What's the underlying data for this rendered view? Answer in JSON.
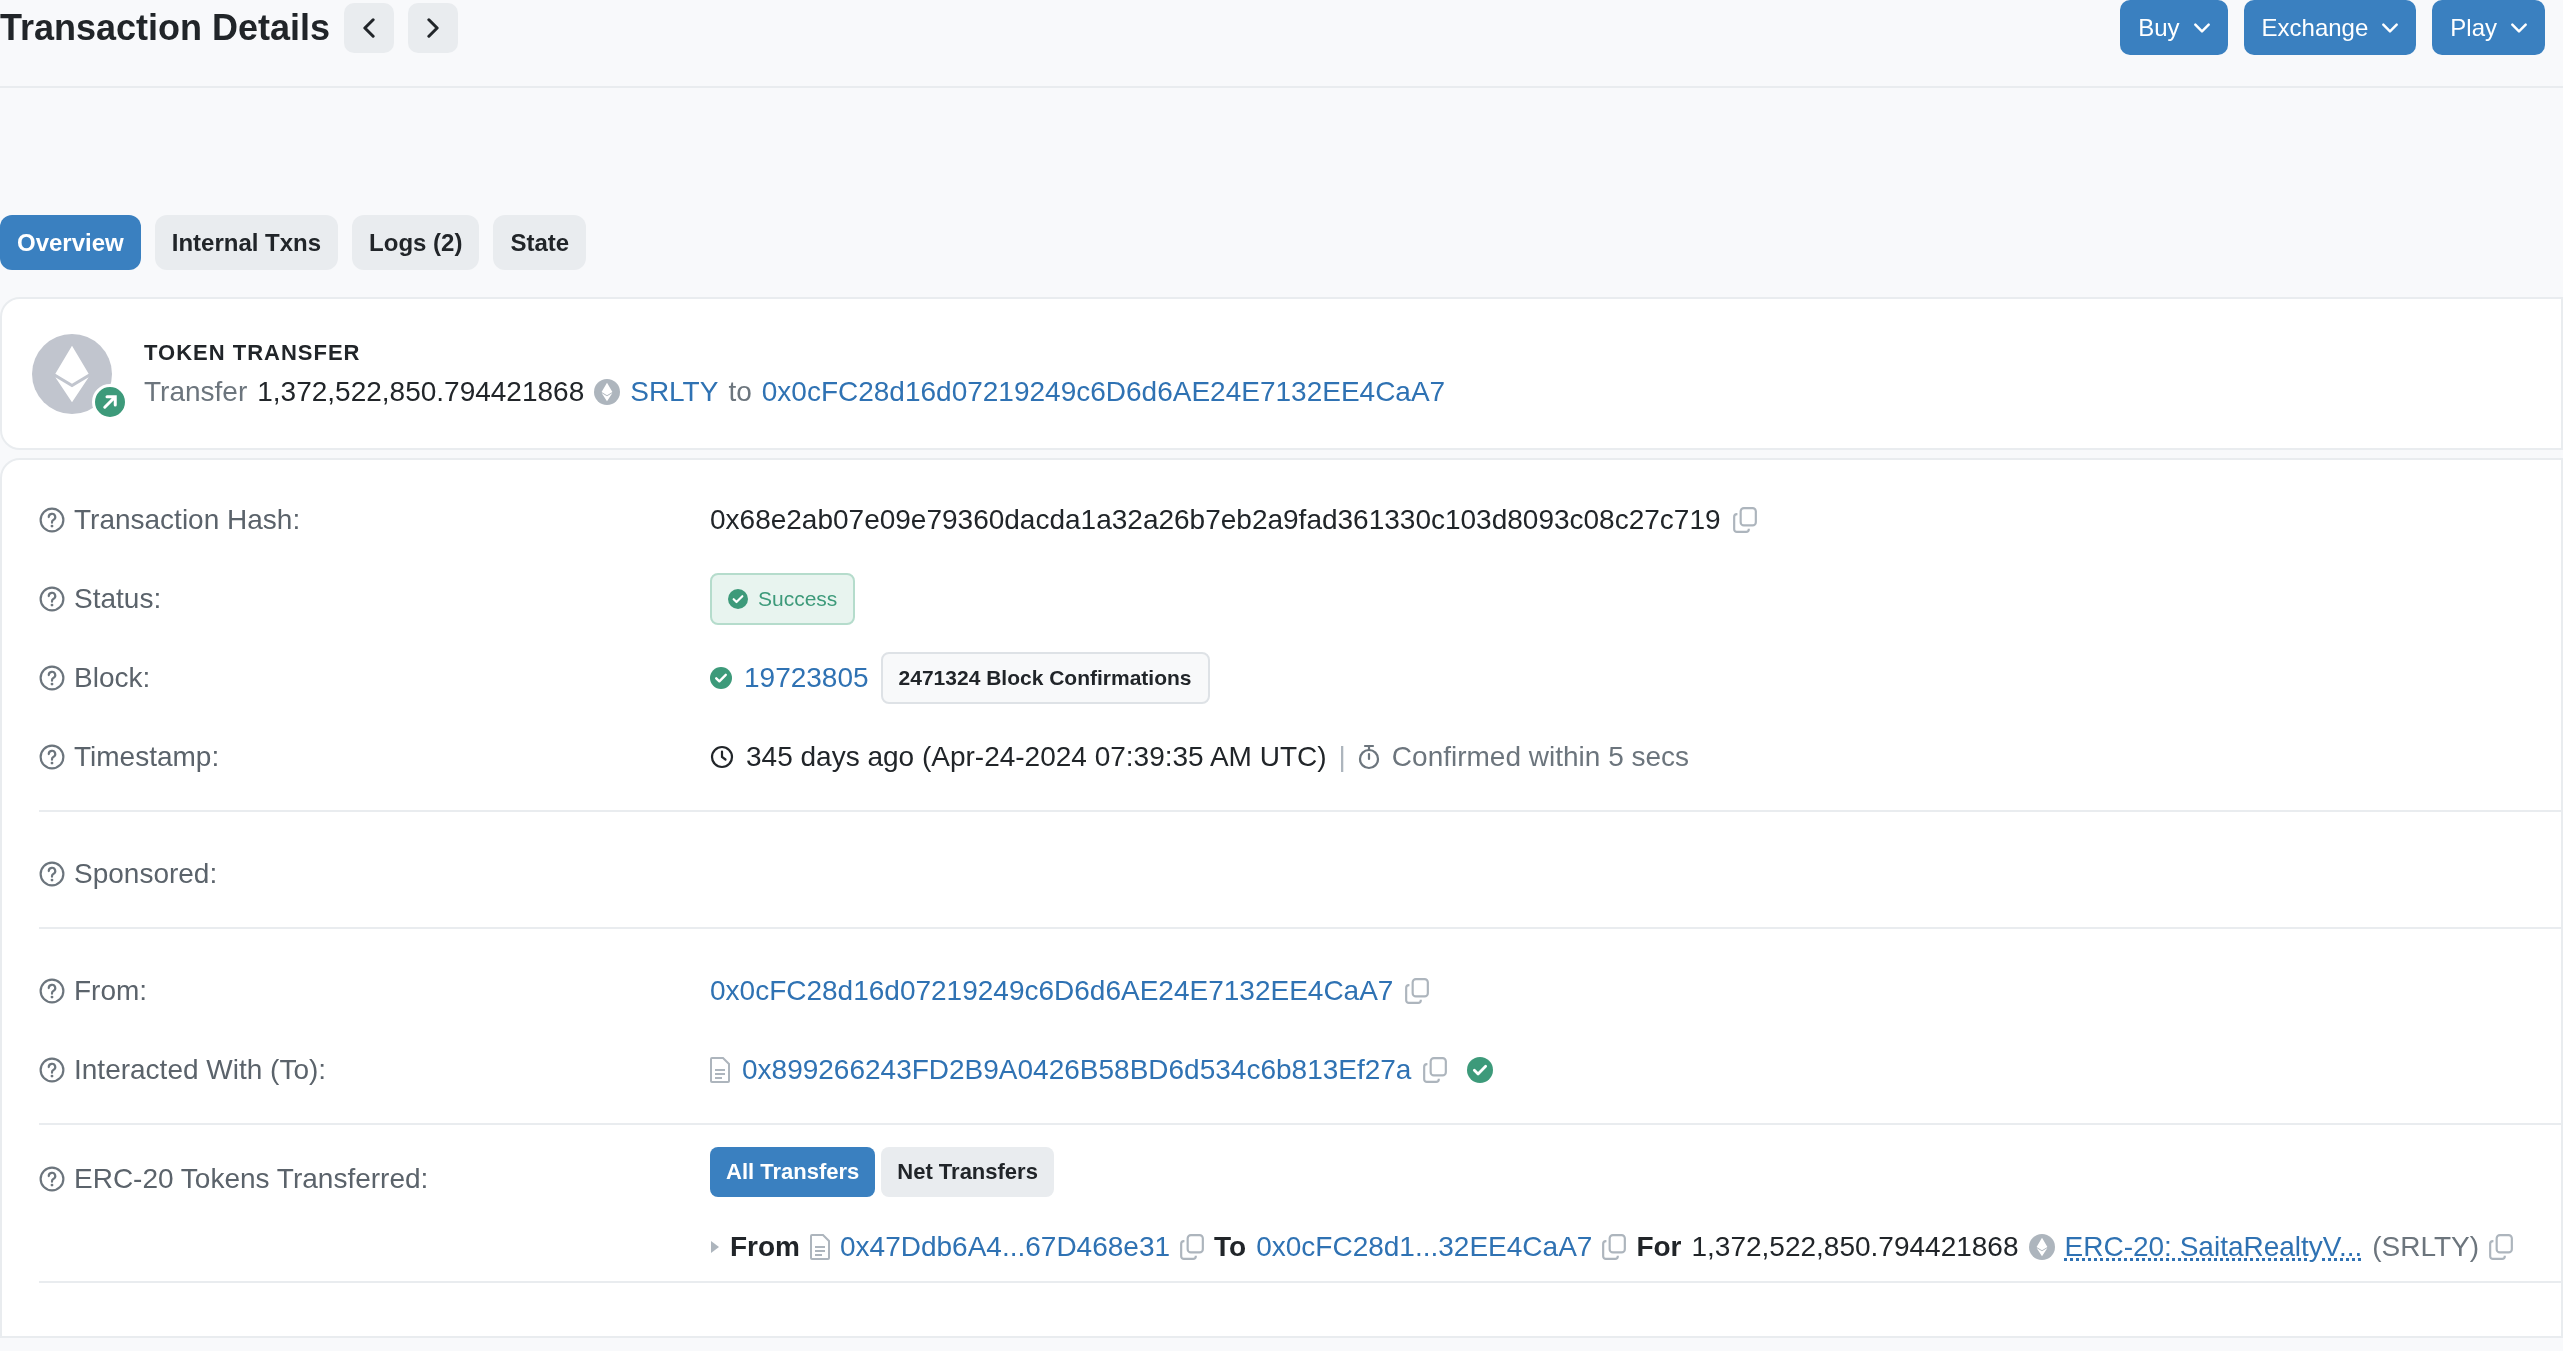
{
  "header": {
    "title": "Transaction Details",
    "menus": [
      {
        "label": "Buy"
      },
      {
        "label": "Exchange"
      },
      {
        "label": "Play"
      }
    ]
  },
  "tabs": [
    {
      "label": "Overview",
      "selected": true
    },
    {
      "label": "Internal Txns",
      "selected": false
    },
    {
      "label": "Logs (2)",
      "selected": false
    },
    {
      "label": "State",
      "selected": false
    }
  ],
  "token_transfer": {
    "heading": "TOKEN TRANSFER",
    "verb": "Transfer",
    "amount": "1,372,522,850.794421868",
    "token": "SRLTY",
    "connector": "to",
    "recipient": "0x0cFC28d16d07219249c6D6d6AE24E7132EE4CaA7"
  },
  "sections": [
    [
      {
        "kind": "hash",
        "label": "Transaction Hash:",
        "value": "0x68e2ab07e09e79360dacda1a32a26b7eb2a9fad361330c103d8093c08c27c719"
      },
      {
        "kind": "status",
        "label": "Status:",
        "value": "Success"
      },
      {
        "kind": "block",
        "label": "Block:",
        "number": "19723805",
        "confirmations": "2471324 Block Confirmations"
      },
      {
        "kind": "timestamp",
        "label": "Timestamp:",
        "age": "345 days ago (Apr-24-2024 07:39:35 AM UTC)",
        "separator": "|",
        "confirmed": "Confirmed within 5 secs"
      }
    ],
    [
      {
        "kind": "empty",
        "label": "Sponsored:"
      }
    ],
    [
      {
        "kind": "address",
        "label": "From:",
        "value": "0x0cFC28d16d07219249c6D6d6AE24E7132EE4CaA7",
        "contract": false,
        "verified": false
      },
      {
        "kind": "address",
        "label": "Interacted With (To):",
        "value": "0x899266243FD2B9A0426B58BD6d534c6b813Ef27a",
        "contract": true,
        "verified": true
      }
    ],
    [
      {
        "kind": "erc20",
        "label": "ERC-20 Tokens Transferred:",
        "filters": [
          {
            "label": "All Transfers",
            "selected": true
          },
          {
            "label": "Net Transfers",
            "selected": false
          }
        ],
        "transfer": {
          "from_label": "From",
          "from": "0x47Ddb6A4...67D468e31",
          "to_label": "To",
          "to": "0x0cFC28d1...32EE4CaA7",
          "for_label": "For",
          "amount": "1,372,522,850.794421868",
          "token": "ERC-20: SaitaRealtyV...",
          "symbol": "(SRLTY)"
        }
      }
    ]
  ]
}
